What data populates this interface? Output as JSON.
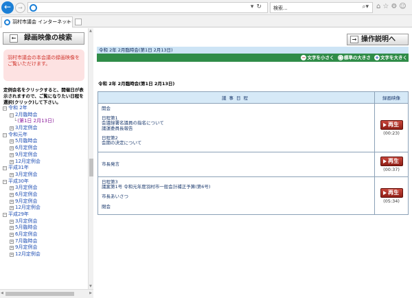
{
  "browser": {
    "search_placeholder": "検索...",
    "tab_title": "羽村市議会 インターネット中継"
  },
  "sidebar": {
    "search_button": "録画映像の検索",
    "notice": "羽村市議会の本会議の録画映像をご覧いただけます。",
    "help": "定例会名をクリックすると、開催日が表示されますので、ご覧になりたい日程を選択(クリック)して下さい。",
    "tree": [
      {
        "level": 1,
        "label": "令和 2年",
        "sign": "⊟"
      },
      {
        "level": 2,
        "label": "2月臨時会",
        "sign": "⊟"
      },
      {
        "level": 3,
        "label": "(第1日 2月13日)"
      },
      {
        "level": 2,
        "label": "3月定例会",
        "sign": "⊞"
      },
      {
        "level": 1,
        "label": "令和元年",
        "sign": "⊟"
      },
      {
        "level": 2,
        "label": "5月臨時会",
        "sign": "⊞"
      },
      {
        "level": 2,
        "label": "6月定例会",
        "sign": "⊞"
      },
      {
        "level": 2,
        "label": "9月定例会",
        "sign": "⊞"
      },
      {
        "level": 2,
        "label": "12月定例会",
        "sign": "⊞"
      },
      {
        "level": 1,
        "label": "平成31年",
        "sign": "⊟"
      },
      {
        "level": 2,
        "label": "3月定例会",
        "sign": "⊞"
      },
      {
        "level": 1,
        "label": "平成30年",
        "sign": "⊟"
      },
      {
        "level": 2,
        "label": "3月定例会",
        "sign": "⊞"
      },
      {
        "level": 2,
        "label": "6月定例会",
        "sign": "⊞"
      },
      {
        "level": 2,
        "label": "9月定例会",
        "sign": "⊞"
      },
      {
        "level": 2,
        "label": "12月定例会",
        "sign": "⊞"
      },
      {
        "level": 1,
        "label": "平成29年",
        "sign": "⊟"
      },
      {
        "level": 2,
        "label": "3月定例会",
        "sign": "⊞"
      },
      {
        "level": 2,
        "label": "5月臨時会",
        "sign": "⊞"
      },
      {
        "level": 2,
        "label": "6月定例会",
        "sign": "⊞"
      },
      {
        "level": 2,
        "label": "7月臨時会",
        "sign": "⊞"
      },
      {
        "level": 2,
        "label": "9月定例会",
        "sign": "⊞"
      },
      {
        "level": 2,
        "label": "12月定例会",
        "sign": "⊞"
      }
    ]
  },
  "main": {
    "help_button": "操作説明へ",
    "header": "令和 2年 2月臨時会(第1日 2月13日)",
    "size_buttons": {
      "smaller": "文字を小さく",
      "normal": "標準の大きさ",
      "larger": "文字を大きく"
    },
    "meeting_title": "令和 2年 2月臨時会(第1日 2月13日)",
    "table": {
      "col_agenda": "議事日程",
      "col_video": "録画映像",
      "play_label": "再生",
      "rows": [
        {
          "items": [
            "開会",
            "",
            "日程第1",
            "会議録署名議員の指名について",
            "議運委員長報告",
            "",
            "日程第2",
            "会期の決定について"
          ],
          "duration": "(00:23)"
        },
        {
          "items": [
            "市長発言"
          ],
          "duration": "(00:37)"
        },
        {
          "items": [
            "日程第3",
            "議案第1号 令和元年度羽村市一般会計補正予算(第6号)",
            "",
            "市長あいさつ",
            "",
            "閉会"
          ],
          "duration": "(05:34)"
        }
      ]
    }
  }
}
